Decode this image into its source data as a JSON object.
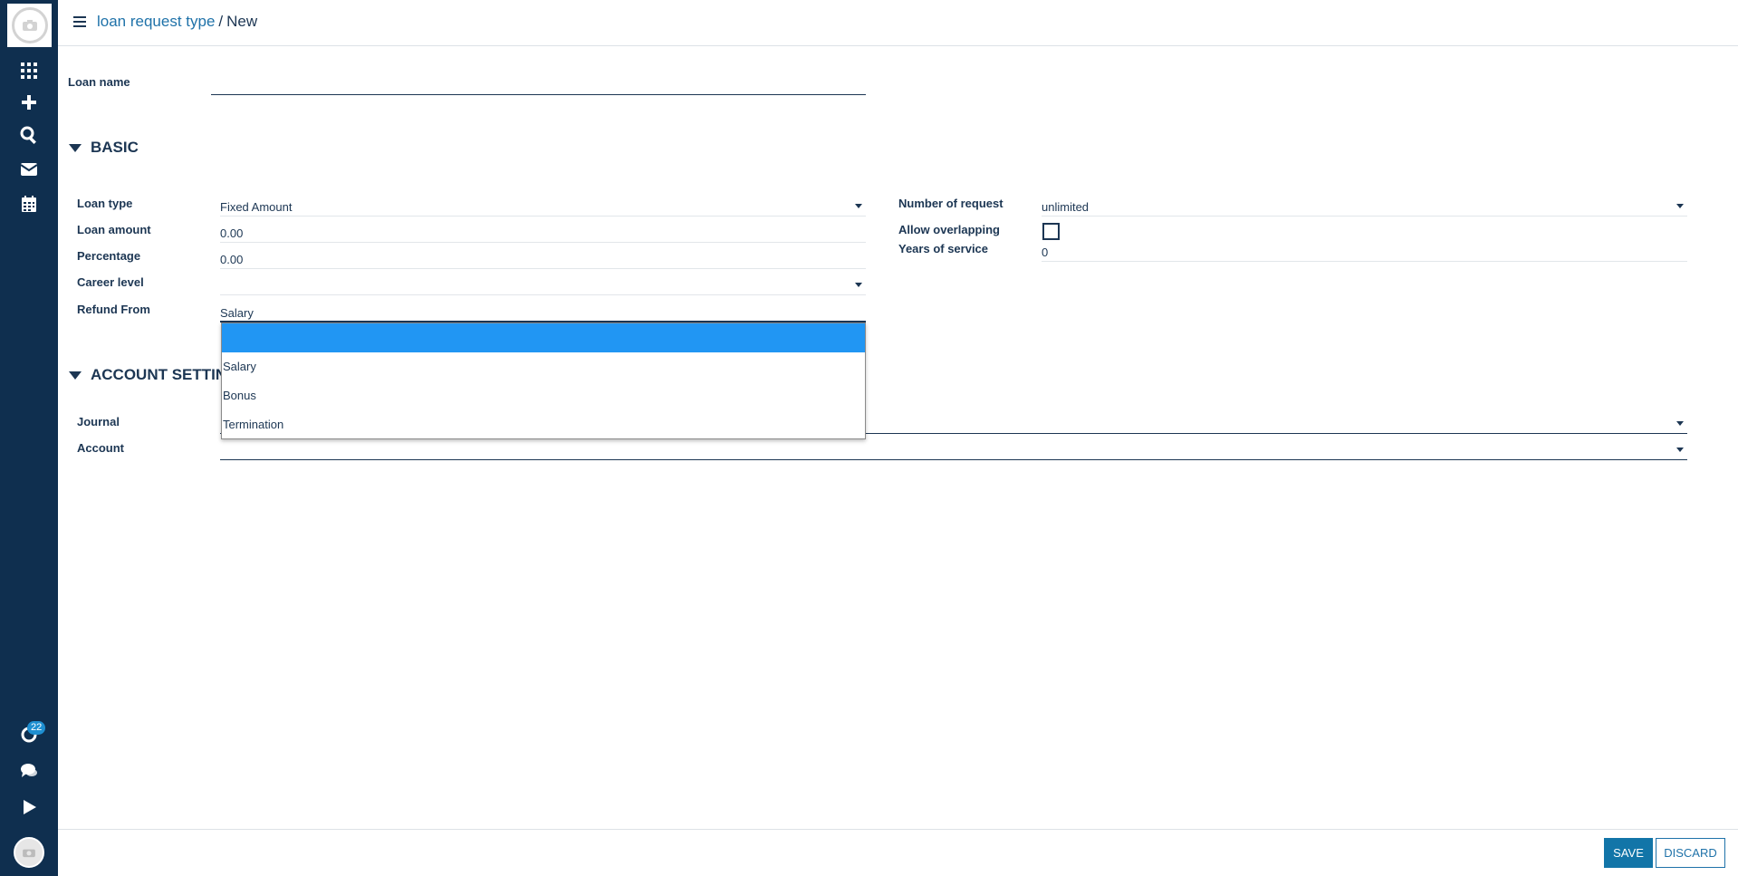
{
  "app": {
    "breadcrumb": {
      "parent": "loan request type",
      "separator": "/",
      "current": "New"
    },
    "notification_count": "22"
  },
  "form": {
    "loan_name_label": "Loan name",
    "loan_name_value": "",
    "sections": {
      "basic": "BASIC",
      "account_settings": "ACCOUNT SETTIN"
    },
    "fields": {
      "loan_type": {
        "label": "Loan type",
        "value": "Fixed Amount"
      },
      "loan_amount": {
        "label": "Loan amount",
        "value": "0.00"
      },
      "percentage": {
        "label": "Percentage",
        "value": "0.00"
      },
      "career_level": {
        "label": "Career level",
        "value": ""
      },
      "refund_from": {
        "label": "Refund From",
        "value": "Salary"
      },
      "number_of_request": {
        "label": "Number of request",
        "value": "unlimited"
      },
      "allow_overlapping": {
        "label": "Allow overlapping",
        "checked": false
      },
      "years_of_service": {
        "label": "Years of service",
        "value": "0"
      },
      "journal": {
        "label": "Journal",
        "value": ""
      },
      "account": {
        "label": "Account",
        "value": ""
      }
    },
    "refund_dropdown_options": [
      "",
      "Salary",
      "Bonus",
      "Termination"
    ]
  },
  "footer": {
    "save_label": "SAVE",
    "discard_label": "DISCARD"
  },
  "colors": {
    "sidebar": "#0f2f4f",
    "accent": "#1275a8",
    "selected_option": "#2196f3"
  }
}
